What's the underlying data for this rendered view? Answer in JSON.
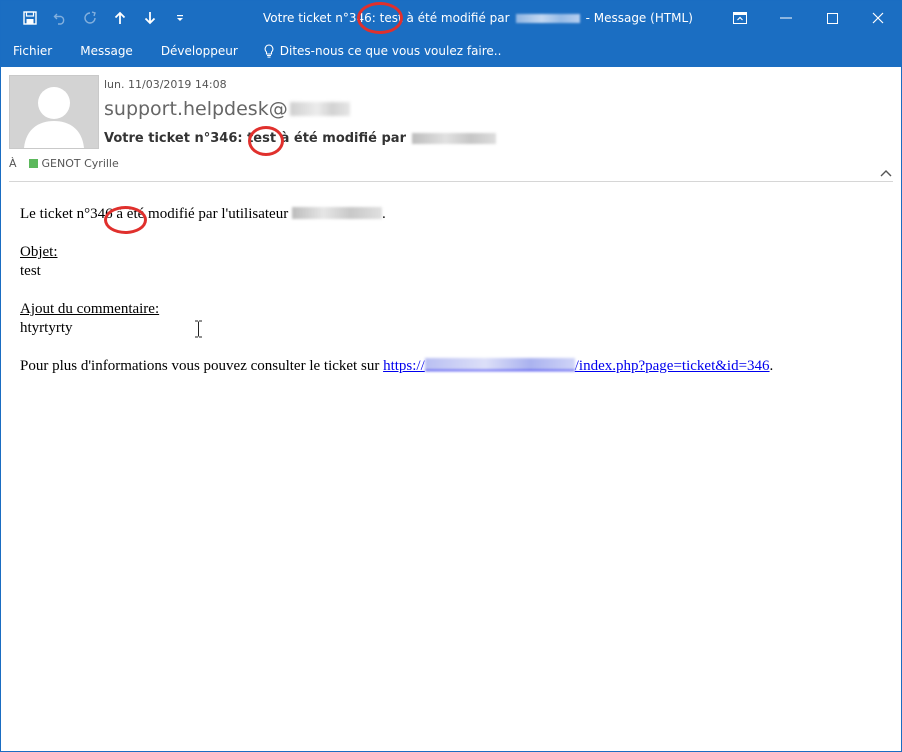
{
  "window": {
    "title_prefix": "Votre ticket n°346: test à été modifié par",
    "title_suffix": "- Message (HTML)",
    "accent": "#1b6ec2"
  },
  "qat": [
    "save-icon",
    "undo-icon",
    "redo-icon",
    "up-arrow-icon",
    "down-arrow-icon",
    "customize-icon"
  ],
  "tabs": [
    "Fichier",
    "Message",
    "Développeur"
  ],
  "tellme": {
    "label": "Dites-nous ce que vous voulez faire..",
    "icon": "lightbulb-icon"
  },
  "header": {
    "date": "lun. 11/03/2019 14:08",
    "sender": "support.helpdesk@",
    "subject": "Votre ticket n°346: test à été modifié par",
    "to_label": "À",
    "recipient": "GENOT Cyrille",
    "presence_color": "#5cb85c"
  },
  "body": {
    "line1_prefix": "Le ticket n°346 à été modifié par l'utilisateur",
    "line1_suffix": ".",
    "objet_label": "Objet:",
    "objet_value": "test",
    "comment_label": "Ajout du commentaire:",
    "comment_value": "htyrtyrty",
    "info_prefix": "Pour plus d'informations vous pouvez consulter le ticket sur",
    "link_start": "https://",
    "link_end": "/index.php?page=ticket&id=346",
    "info_suffix": ".",
    "annotation_color": "#e0302d"
  }
}
